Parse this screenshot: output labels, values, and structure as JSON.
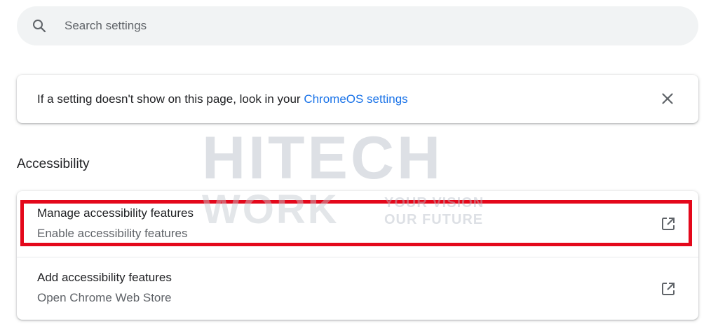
{
  "search": {
    "placeholder": "Search settings",
    "icon": "search-icon"
  },
  "notice": {
    "text": "If a setting doesn't show on this page, look in your ",
    "link_label": "ChromeOS settings",
    "close_icon": "close-icon"
  },
  "section": {
    "title": "Accessibility"
  },
  "items": [
    {
      "title": "Manage accessibility features",
      "subtitle": "Enable accessibility features",
      "icon": "external-link-icon"
    },
    {
      "title": "Add accessibility features",
      "subtitle": "Open Chrome Web Store",
      "icon": "external-link-icon"
    }
  ],
  "watermark": {
    "line1": "HITECH",
    "line2": "WORK",
    "tagline1": "YOUR VISION",
    "tagline2": "OUR FUTURE"
  },
  "colors": {
    "accent_link": "#1a73e8",
    "highlight": "#e4081b",
    "search_bg": "#f1f3f4"
  }
}
